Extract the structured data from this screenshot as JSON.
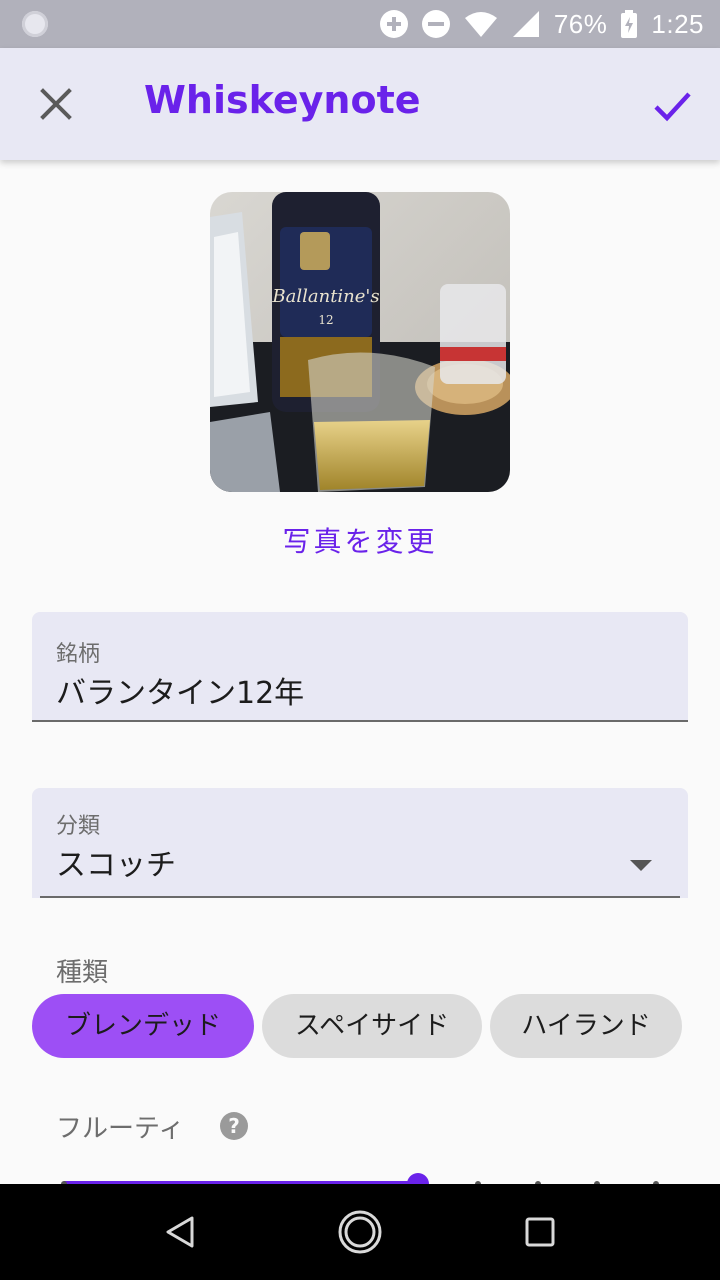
{
  "status_bar": {
    "battery": "76%",
    "time": "1:25",
    "icons": [
      "notification-icon",
      "data-saver-icon",
      "dnd-icon",
      "wifi-icon",
      "signal-icon",
      "battery-icon"
    ]
  },
  "app_bar": {
    "title": "Whiskeynote",
    "close_icon": "close-icon",
    "confirm_icon": "check-icon"
  },
  "photo": {
    "bottle_label": "Ballantine's",
    "bottle_age": "12",
    "change_label": "写真を変更"
  },
  "fields": {
    "brand": {
      "label": "銘柄",
      "value": "バランタイン12年"
    },
    "category": {
      "label": "分類",
      "value": "スコッチ"
    }
  },
  "type_section": {
    "label": "種類",
    "chips": [
      {
        "label": "ブレンデッド",
        "selected": true
      },
      {
        "label": "スペイサイド",
        "selected": false
      },
      {
        "label": "ハイランド",
        "selected": false
      }
    ]
  },
  "fruity": {
    "label": "フルーティ",
    "help_icon": "help-icon",
    "help_glyph": "?",
    "level": 0.6
  },
  "colors": {
    "accent": "#6a22ea",
    "chip_selected": "#9d4ff5",
    "app_bar": "#e8e8f4",
    "status_bar": "#b1b1bb"
  }
}
